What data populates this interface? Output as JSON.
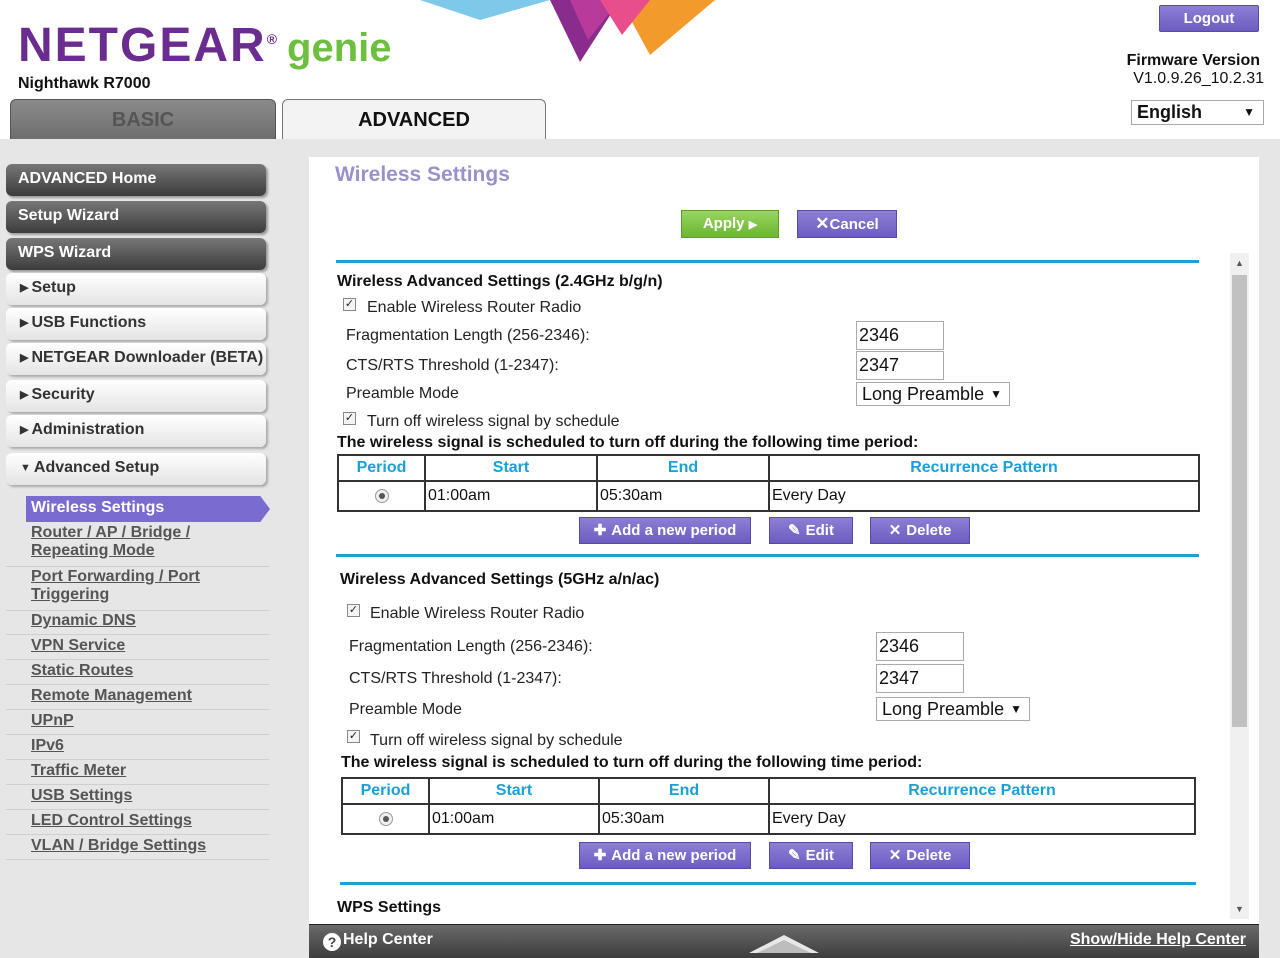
{
  "header": {
    "brand_main": "NETGEAR",
    "brand_reg": "®",
    "brand_genie": "genie",
    "model": "Nighthawk R7000",
    "logout_label": "Logout",
    "firmware_label": "Firmware Version",
    "firmware_value": "V1.0.9.26_10.2.31",
    "language": "English",
    "tabs": [
      {
        "label": "BASIC",
        "active": false
      },
      {
        "label": "ADVANCED",
        "active": true
      }
    ]
  },
  "sidebar": {
    "top_items": [
      {
        "label": "ADVANCED Home"
      },
      {
        "label": "Setup Wizard"
      },
      {
        "label": "WPS Wizard"
      }
    ],
    "sections": [
      {
        "label": "Setup",
        "expanded": false
      },
      {
        "label": "USB Functions",
        "expanded": false
      },
      {
        "label": "NETGEAR Downloader (BETA)",
        "expanded": false
      },
      {
        "label": "Security",
        "expanded": false
      },
      {
        "label": "Administration",
        "expanded": false
      },
      {
        "label": "Advanced Setup",
        "expanded": true
      }
    ],
    "active_sub": "Wireless Settings",
    "sub_items": [
      {
        "label": "Router / AP / Bridge / Repeating Mode"
      },
      {
        "label": "Port Forwarding / Port Triggering"
      },
      {
        "label": "Dynamic DNS"
      },
      {
        "label": "VPN Service"
      },
      {
        "label": "Static Routes"
      },
      {
        "label": "Remote Management"
      },
      {
        "label": "UPnP"
      },
      {
        "label": "IPv6"
      },
      {
        "label": "Traffic Meter"
      },
      {
        "label": "USB Settings"
      },
      {
        "label": "LED Control Settings"
      },
      {
        "label": "VLAN / Bridge Settings"
      }
    ]
  },
  "main": {
    "title": "Wireless Settings",
    "apply_label": "Apply",
    "cancel_label": "Cancel",
    "band24": {
      "title": "Wireless Advanced Settings (2.4GHz b/g/n)",
      "enable_radio_label": "Enable Wireless Router Radio",
      "enable_radio_checked": true,
      "frag_label": "Fragmentation Length (256-2346):",
      "frag_value": "2346",
      "cts_label": "CTS/RTS Threshold (1-2347):",
      "cts_value": "2347",
      "preamble_label": "Preamble Mode",
      "preamble_value": "Long Preamble",
      "schedule_label": "Turn off wireless signal by schedule",
      "schedule_checked": true,
      "schedule_note": "The wireless signal is scheduled to turn off during the following time period:",
      "table_headers": [
        "Period",
        "Start",
        "End",
        "Recurrence Pattern"
      ],
      "rows": [
        {
          "start": "01:00am",
          "end": "05:30am",
          "recurrence": "Every Day"
        }
      ],
      "add_label": "Add a new period",
      "edit_label": "Edit",
      "delete_label": "Delete"
    },
    "band5": {
      "title": "Wireless Advanced Settings (5GHz a/n/ac)",
      "enable_radio_label": "Enable Wireless Router Radio",
      "enable_radio_checked": true,
      "frag_label": "Fragmentation Length (256-2346):",
      "frag_value": "2346",
      "cts_label": "CTS/RTS Threshold (1-2347):",
      "cts_value": "2347",
      "preamble_label": "Preamble Mode",
      "preamble_value": "Long Preamble",
      "schedule_label": "Turn off wireless signal by schedule",
      "schedule_checked": true,
      "schedule_note": "The wireless signal is scheduled to turn off during the following time period:",
      "table_headers": [
        "Period",
        "Start",
        "End",
        "Recurrence Pattern"
      ],
      "rows": [
        {
          "start": "01:00am",
          "end": "05:30am",
          "recurrence": "Every Day"
        }
      ],
      "add_label": "Add a new period",
      "edit_label": "Edit",
      "delete_label": "Delete"
    },
    "wps_title": "WPS Settings"
  },
  "help_bar": {
    "label": "Help Center",
    "toggle_label": "Show/Hide Help Center"
  },
  "colors": {
    "accent_purple": "#7a6bd0",
    "rule_blue": "#1aa0d6",
    "apply_green": "#6bb630",
    "brand_purple": "#6b2c8f",
    "genie_green": "#6cbf3f"
  },
  "icons": {
    "logo_decor": "netgear-triangles",
    "apply_arrow": "play-arrow-icon",
    "cancel_x": "close-icon",
    "add": "plus-icon",
    "edit": "pencil-icon",
    "delete": "close-icon",
    "help": "question-icon",
    "scroll_up": "triangle-up-icon",
    "scroll_down": "triangle-down-icon"
  }
}
